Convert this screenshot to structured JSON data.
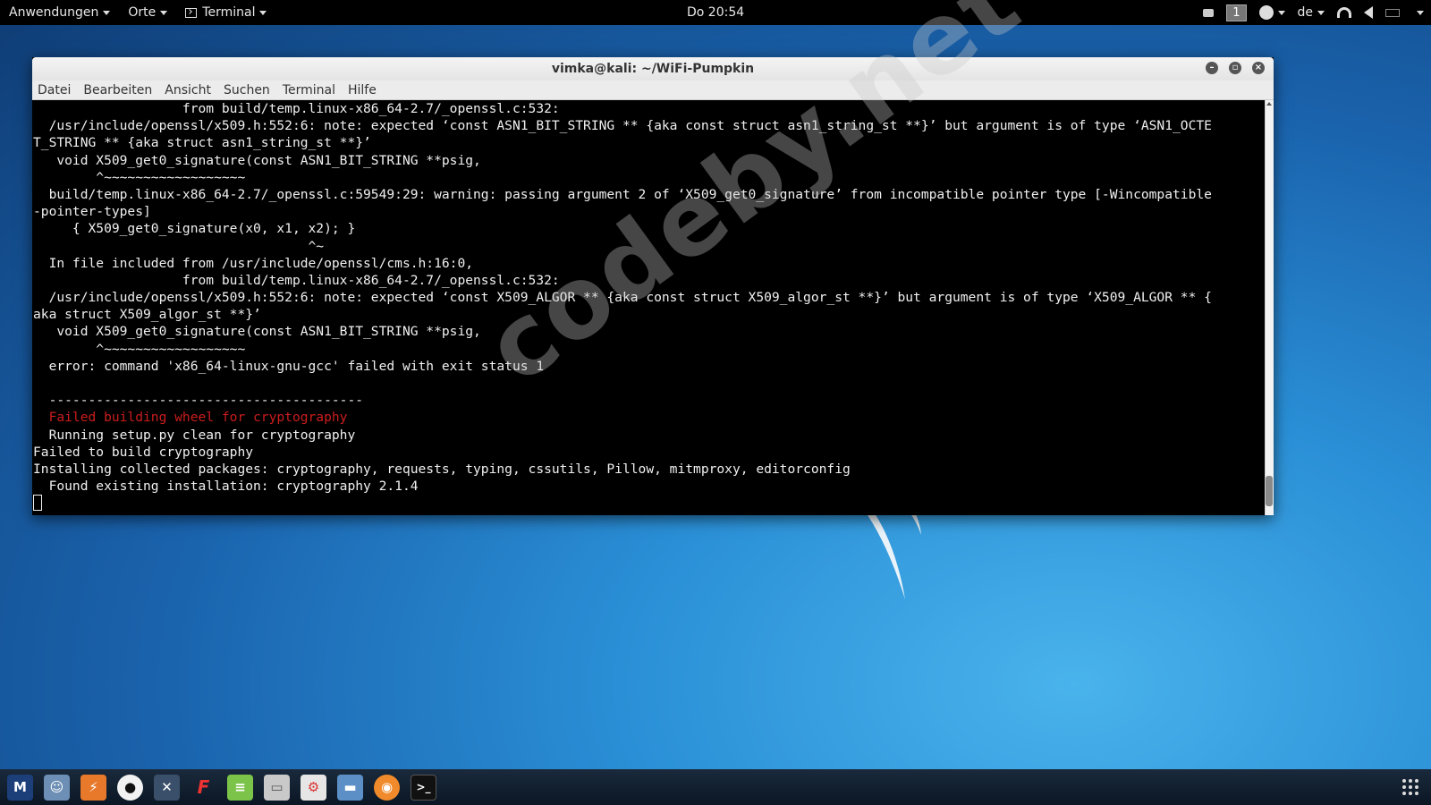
{
  "topbar": {
    "applications": "Anwendungen",
    "places": "Orte",
    "terminal": "Terminal",
    "clock": "Do 20:54",
    "workspace": "1",
    "language": "de"
  },
  "window": {
    "title": "vimka@kali: ~/WiFi-Pumpkin",
    "menu": [
      "Datei",
      "Bearbeiten",
      "Ansicht",
      "Suchen",
      "Terminal",
      "Hilfe"
    ]
  },
  "terminal": {
    "lines": [
      "                   from build/temp.linux-x86_64-2.7/_openssl.c:532:",
      "  /usr/include/openssl/x509.h:552:6: note: expected ‘const ASN1_BIT_STRING ** {aka const struct asn1_string_st **}’ but argument is of type ‘ASN1_OCTE",
      "T_STRING ** {aka struct asn1_string_st **}’",
      "   void X509_get0_signature(const ASN1_BIT_STRING **psig,",
      "        ^~~~~~~~~~~~~~~~~~~",
      "  build/temp.linux-x86_64-2.7/_openssl.c:59549:29: warning: passing argument 2 of ‘X509_get0_signature’ from incompatible pointer type [-Wincompatible",
      "-pointer-types]",
      "     { X509_get0_signature(x0, x1, x2); }",
      "                                   ^~",
      "  In file included from /usr/include/openssl/cms.h:16:0,",
      "                   from build/temp.linux-x86_64-2.7/_openssl.c:532:",
      "  /usr/include/openssl/x509.h:552:6: note: expected ‘const X509_ALGOR ** {aka const struct X509_algor_st **}’ but argument is of type ‘X509_ALGOR ** {",
      "aka struct X509_algor_st **}’",
      "   void X509_get0_signature(const ASN1_BIT_STRING **psig,",
      "        ^~~~~~~~~~~~~~~~~~~",
      "  error: command 'x86_64-linux-gnu-gcc' failed with exit status 1",
      "",
      "  ----------------------------------------",
      "  Failed building wheel for cryptography",
      "  Running setup.py clean for cryptography",
      "Failed to build cryptography",
      "Installing collected packages: cryptography, requests, typing, cssutils, Pillow, mitmproxy, editorconfig",
      "  Found existing installation: cryptography 2.1.4"
    ],
    "error_line_index": 18
  },
  "watermark": "codeby.net",
  "dock": {
    "icons": [
      "metasploit-icon",
      "armitage-icon",
      "burpsuite-icon",
      "beef-icon",
      "maltego-icon",
      "faraday-icon",
      "leafpad-icon",
      "cutecom-icon",
      "settings-icon",
      "files-icon",
      "firefox-icon",
      "terminal-icon"
    ]
  }
}
